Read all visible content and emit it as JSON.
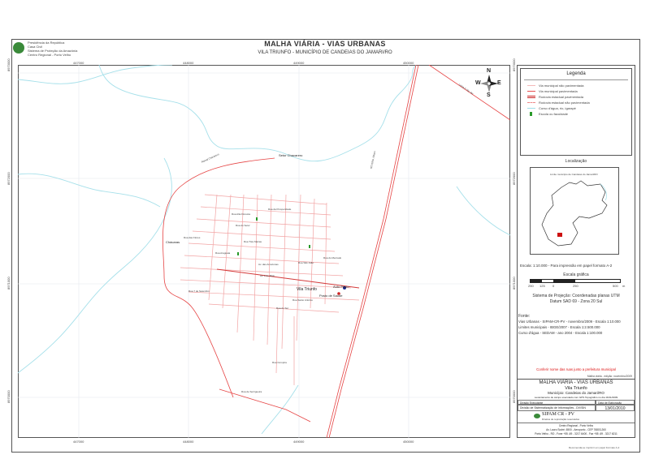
{
  "header": {
    "org_lines": [
      "Presidência da República",
      "Casa Civil",
      "Sistema de Proteção da Amazônia",
      "Centro Regional - Porto Velho"
    ],
    "title": "MALHA VIÁRIA - VIAS URBANAS",
    "subtitle": "VILA TRIUNFO -  MUNICÍPIO DE CANDEIAS DO JAMARI/RO"
  },
  "grid": {
    "top_ticks": [
      "447000",
      "448000",
      "449000",
      "450000"
    ],
    "bottom_ticks": [
      "447000",
      "448000",
      "449000",
      "450000"
    ],
    "left_ticks": [
      "8973000",
      "8972000",
      "8971000",
      "8970000"
    ],
    "right_ticks": [
      "8973000",
      "8972000",
      "8971000",
      "8970000"
    ]
  },
  "compass": {
    "n": "N",
    "s": "S",
    "e": "E",
    "w": "W"
  },
  "map_labels": {
    "setor_chacarero": "Setor Chacarero",
    "chacaras": "Chácaras",
    "vila_triunfo": "Vila Triunfo",
    "auto_posto": "Auto Posto",
    "posto_saude": "Posto de Saúde",
    "ramal_chacarero": "Ramal Chacarero",
    "linha_p_rio_ver": "Linha P. Rio Ver",
    "rd_ro": "RO-ENG. Nilson",
    "rua_prosperidade": "Rua da Prosperidade",
    "rua_alta_floresta": "Rua Alta Floresta",
    "rua_do_setor": "Rua do Setor",
    "rua_8_de_maio": "Av. 3 de Maio",
    "rua_7_setembro": "Rua 7 de Setembro",
    "rua_tres_marias": "Rua Três Marias",
    "rua_araguaia": "Rua Araguaia",
    "rua_sao_joao": "Rua São João",
    "av_das_amazonas": "Av. das Amazonas",
    "rua_do_sul": "Rua do Sul",
    "rua_santo_antonio": "Rua Santo Antônio",
    "rua_das_flores": "Rua das Flores",
    "rua_de_serrigueira": "Rua de Serrigueira",
    "rua_do_mercado": "Rua do Mercado",
    "rua_curupira": "Rua Curupira"
  },
  "legend": {
    "title": "Legenda",
    "items": [
      {
        "label": "Via municipal não pavimentada",
        "color": "#f4b9b9",
        "style": "solid"
      },
      {
        "label": "Via municipal pavimentada",
        "color": "#e85050",
        "style": "solid"
      },
      {
        "label": "Rodovia estadual pavimentada",
        "color": "#cc2222",
        "style": "double"
      },
      {
        "label": "Rodovia estadual não pavimentada",
        "color": "#e88",
        "style": "dashed"
      },
      {
        "label": "Curso d'água, rio, igarapé",
        "color": "#9fdde8",
        "style": "solid"
      },
      {
        "label": "Escola ou faculdade",
        "color": "#2a9a2a",
        "style": "icon"
      }
    ]
  },
  "location": {
    "title": "Localização",
    "caption": "Limite município de Candeias do Jamari/RO"
  },
  "scale": {
    "text": "Escala: 1:10.000 - Para impressão em papel formato A-2",
    "graphic_title": "Escala gráfica",
    "ticks": [
      "250",
      "125",
      "0",
      "250",
      "500"
    ],
    "unit": "m"
  },
  "projection": {
    "line1": "Sistema de Projeção: Coordenadas planas UTM",
    "line2": "Datum SAD 69 - Zona 20 Sul"
  },
  "sources": {
    "title": "Fonte:",
    "lines": [
      "Vias Urbanas - SIPAM-CR-PV - novembro/2009 - Escala 1:10.000",
      "Limites municipais - IBGE/2007 - Escala 1:2.500.000",
      "Curso d'água - SEDAM - ano 2004 - Escala 1:100.000"
    ]
  },
  "note": {
    "red": "Conferir nome das ruas junto a prefeitura municipal",
    "small": "Malha viária - edição: novembro/2009"
  },
  "titleblock": {
    "l1": "MALHA VIÁRIA - VIAS URBANAS",
    "l2": "Vila Triunfo",
    "l3": "Município: Candeias do Jamari/RO",
    "l4": "Levantamento de campo executado com GPS Topográfico no dia 16/11/2009",
    "h_exec": "Divisão Executante",
    "h_date": "Data de Elaboração",
    "exec": "Divisão de Sistematização de Informações - DV/SIN",
    "date": "13/01/2010",
    "sipam": "SIPAM CR - PV",
    "sipam_sub": "Direitos de reprodução reservados",
    "addr1": "Centro Regional - Porto Velho",
    "addr2": "Av. Lauro Sodré, 6500 - Aeroporto - CEP 76803-260",
    "addr3": "Porto Velho - RO - Fone +55 -69 - 3217 6400 - Fax +55 -69 - 3217 6211"
  },
  "footer": "Recomenda-se imprimir em papel Formato A-2"
}
